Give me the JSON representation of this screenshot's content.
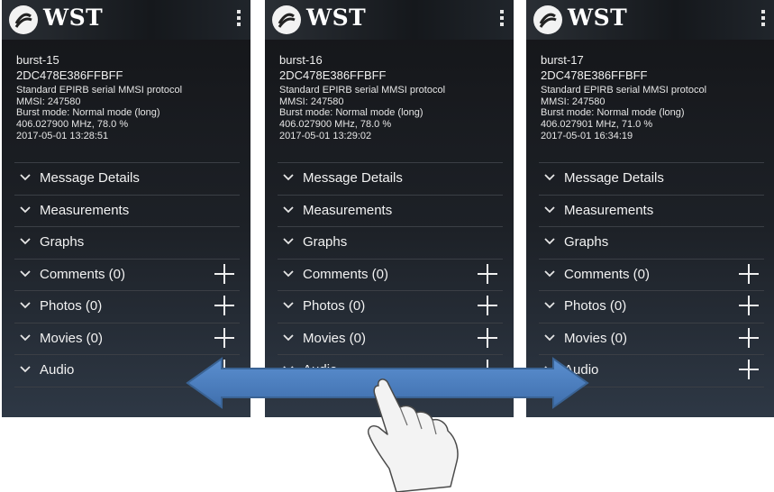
{
  "app": {
    "title": "WST"
  },
  "phones": [
    {
      "burst": "burst-15",
      "hex": "2DC478E386FFBFF",
      "protocol": "Standard EPIRB serial MMSI protocol",
      "mmsi": "MMSI: 247580",
      "mode": "Burst mode: Normal mode (long)",
      "freq": "406.027900 MHz, 78.0 %",
      "date": "2017-05-01 13:28:51",
      "sections": [
        "Message Details",
        "Measurements",
        "Graphs",
        "Comments (0)",
        "Photos (0)",
        "Movies (0)",
        "Audio"
      ]
    },
    {
      "burst": "burst-16",
      "hex": "2DC478E386FFBFF",
      "protocol": "Standard EPIRB serial MMSI protocol",
      "mmsi": "MMSI: 247580",
      "mode": "Burst mode: Normal mode (long)",
      "freq": "406.027900 MHz, 78.0 %",
      "date": "2017-05-01 13:29:02",
      "sections": [
        "Message Details",
        "Measurements",
        "Graphs",
        "Comments (0)",
        "Photos (0)",
        "Movies (0)",
        "Audio"
      ]
    },
    {
      "burst": "burst-17",
      "hex": "2DC478E386FFBFF",
      "protocol": "Standard EPIRB serial MMSI protocol",
      "mmsi": "MMSI: 247580",
      "mode": "Burst mode: Normal mode (long)",
      "freq": "406.027901 MHz, 71.0 %",
      "date": "2017-05-01 16:34:19",
      "sections": [
        "Message Details",
        "Measurements",
        "Graphs",
        "Comments (0)",
        "Photos (0)",
        "Movies (0)",
        "Audio"
      ]
    }
  ],
  "colors": {
    "arrow": "#4f81bd",
    "arrow_border": "#3a6394",
    "screen_bg": "#1a1d22"
  },
  "icons": {
    "logo": "wst-logo-icon",
    "menu": "overflow-menu-icon",
    "chevron": "chevron-down-icon",
    "add": "plus-icon",
    "gesture": "swipe-hand-icon"
  }
}
